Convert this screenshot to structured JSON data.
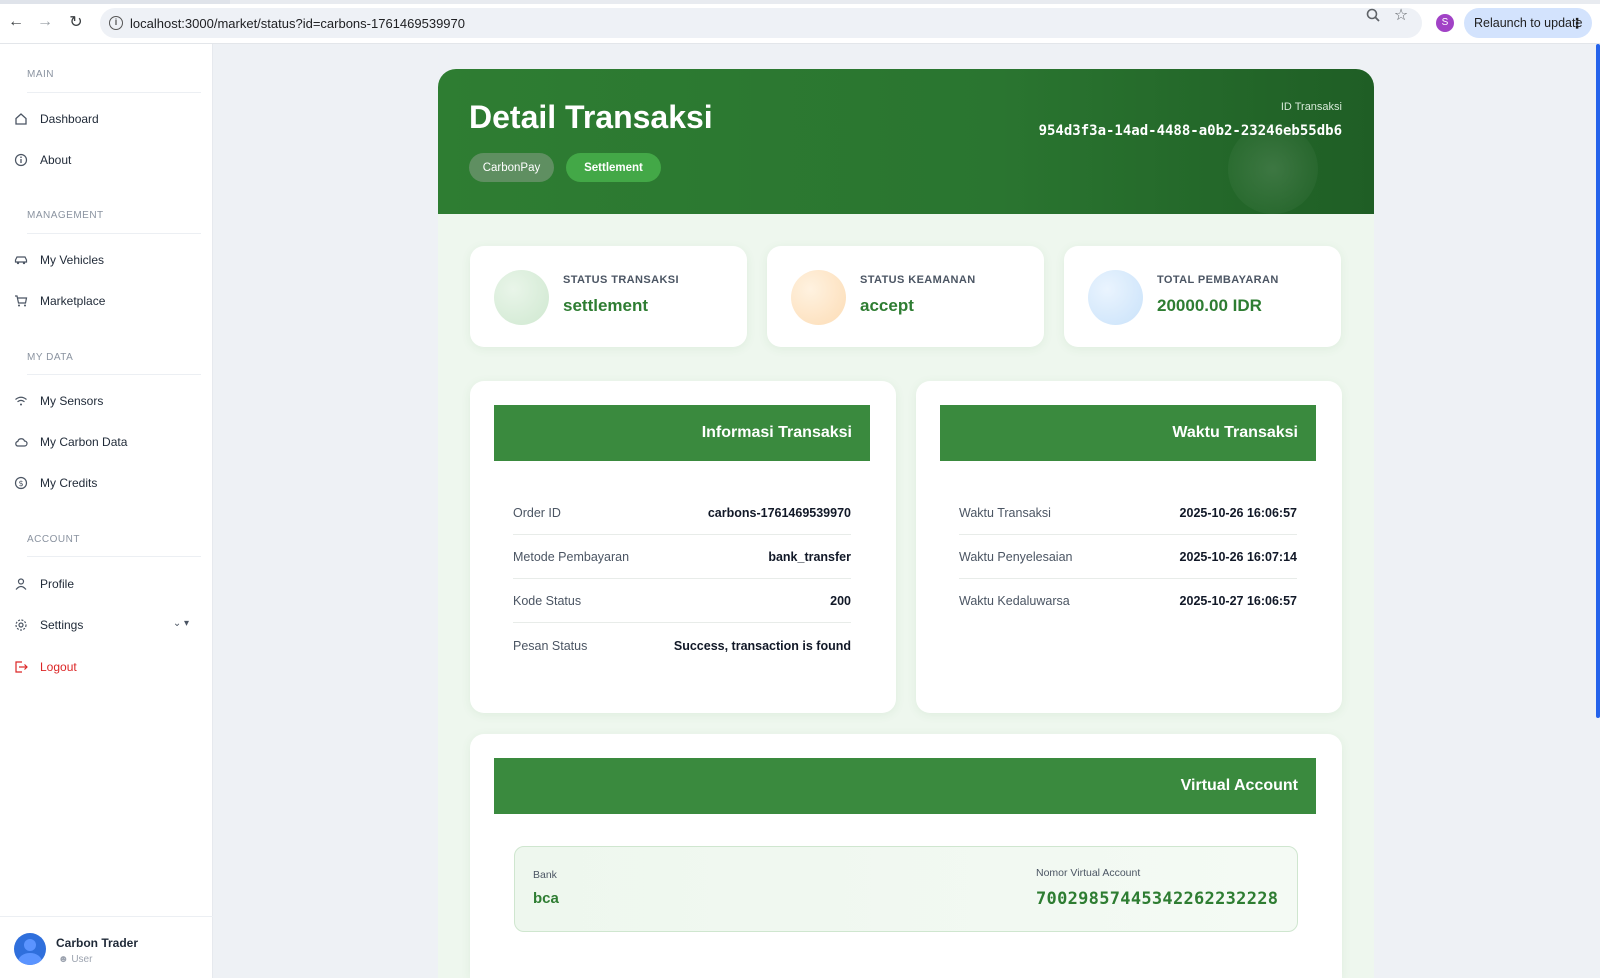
{
  "browser": {
    "url": "localhost:3000/market/status?id=carbons-1761469539970",
    "profile_initial": "S",
    "relaunch_label": "Relaunch to update"
  },
  "sidebar": {
    "sections": {
      "main": "MAIN",
      "management": "MANAGEMENT",
      "my_data": "MY DATA",
      "account": "ACCOUNT"
    },
    "items": {
      "dashboard": "Dashboard",
      "about": "About",
      "vehicles": "My Vehicles",
      "marketplace": "Marketplace",
      "sensors": "My Sensors",
      "carbon_data": "My Carbon Data",
      "credits": "My Credits",
      "profile": "Profile",
      "settings": "Settings",
      "logout": "Logout"
    },
    "user": {
      "name": "Carbon Trader",
      "role": "User"
    }
  },
  "header": {
    "title": "Detail Transaksi",
    "pill_provider": "CarbonPay",
    "pill_status": "Settlement",
    "id_label": "ID Transaksi",
    "id_value": "954d3f3a-14ad-4488-a0b2-23246eb55db6"
  },
  "stats": [
    {
      "label": "STATUS TRANSAKSI",
      "value": "settlement",
      "color": "#dcefdc"
    },
    {
      "label": "STATUS KEAMANAN",
      "value": "accept",
      "color": "#fde3c4"
    },
    {
      "label": "TOTAL PEMBAYARAN",
      "value": "20000.00 IDR",
      "color": "#d4e8fb"
    }
  ],
  "info": {
    "title": "Informasi Transaksi",
    "rows": [
      {
        "key": "Order ID",
        "value": "carbons-1761469539970"
      },
      {
        "key": "Metode Pembayaran",
        "value": "bank_transfer"
      },
      {
        "key": "Kode Status",
        "value": "200"
      },
      {
        "key": "Pesan Status",
        "value": "Success, transaction is found"
      }
    ]
  },
  "time": {
    "title": "Waktu Transaksi",
    "rows": [
      {
        "key": "Waktu Transaksi",
        "value": "2025-10-26 16:06:57"
      },
      {
        "key": "Waktu Penyelesaian",
        "value": "2025-10-26 16:07:14"
      },
      {
        "key": "Waktu Kedaluwarsa",
        "value": "2025-10-27 16:06:57"
      }
    ]
  },
  "virtual_account": {
    "title": "Virtual Account",
    "bank_label": "Bank",
    "bank": "bca",
    "number_label": "Nomor Virtual Account",
    "number": "70029857445342262232228"
  },
  "colors": {
    "brand": "#2e7d32",
    "header_bar": "#3a8a3e",
    "logout": "#dc2626"
  }
}
